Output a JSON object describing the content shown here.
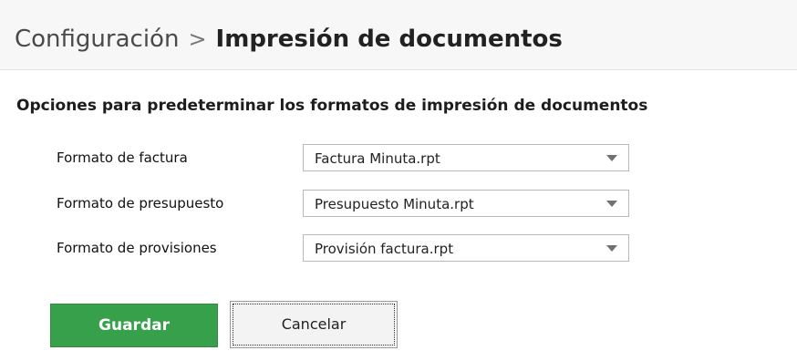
{
  "header": {
    "breadcrumb_parent": "Configuración",
    "breadcrumb_separator": ">",
    "breadcrumb_current": "Impresión de documentos"
  },
  "section": {
    "title": "Opciones para predeterminar los formatos de impresión de documentos"
  },
  "fields": [
    {
      "label": "Formato de factura",
      "value": "Factura Minuta.rpt"
    },
    {
      "label": "Formato de presupuesto",
      "value": "Presupuesto Minuta.rpt"
    },
    {
      "label": "Formato de provisiones",
      "value": "Provisión factura.rpt"
    }
  ],
  "actions": {
    "save_label": "Guardar",
    "cancel_label": "Cancelar"
  },
  "colors": {
    "save_button": "#37a04a",
    "header_bg": "#f7f7f7"
  },
  "icons": {
    "dropdown": "chevron-down-icon"
  }
}
